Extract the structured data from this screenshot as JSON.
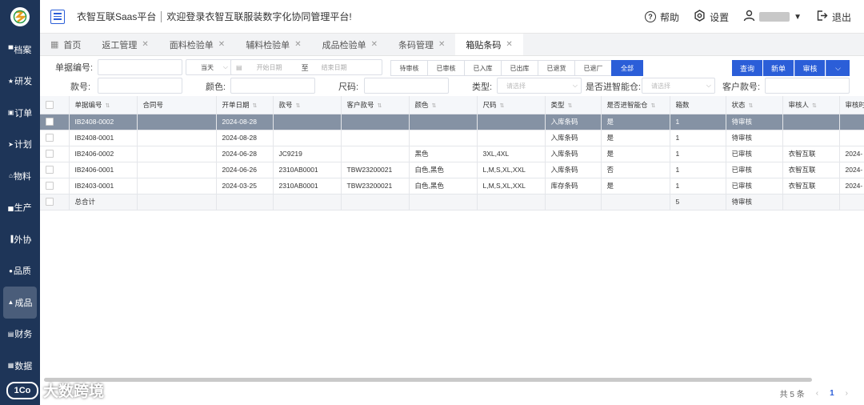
{
  "app": {
    "platform_name": "衣智互联Saas平台",
    "welcome": "欢迎登录衣智互联服装数字化协同管理平台!"
  },
  "topbar": {
    "help": "帮助",
    "settings": "设置",
    "logout": "退出"
  },
  "sidebar": {
    "items": [
      {
        "label": "档案",
        "icon": "archive-icon",
        "active": false
      },
      {
        "label": "研发",
        "icon": "star-icon",
        "active": false
      },
      {
        "label": "订单",
        "icon": "order-icon",
        "active": false
      },
      {
        "label": "计划",
        "icon": "send-icon",
        "active": false
      },
      {
        "label": "物料",
        "icon": "home-icon",
        "active": false
      },
      {
        "label": "生产",
        "icon": "factory-icon",
        "active": false
      },
      {
        "label": "外协",
        "icon": "chart-icon",
        "active": false
      },
      {
        "label": "品质",
        "icon": "check-circle-icon",
        "active": false
      },
      {
        "label": "成品",
        "icon": "bag-icon",
        "active": true
      },
      {
        "label": "财务",
        "icon": "wallet-icon",
        "active": false
      },
      {
        "label": "数据",
        "icon": "data-icon",
        "active": false
      }
    ]
  },
  "tabs": [
    {
      "label": "首页",
      "closable": false,
      "active": false
    },
    {
      "label": "返工管理",
      "closable": true,
      "active": false
    },
    {
      "label": "面料检验单",
      "closable": true,
      "active": false
    },
    {
      "label": "辅料检验单",
      "closable": true,
      "active": false
    },
    {
      "label": "成品检验单",
      "closable": true,
      "active": false
    },
    {
      "label": "条码管理",
      "closable": true,
      "active": false
    },
    {
      "label": "箱贴条码",
      "closable": true,
      "active": true
    }
  ],
  "filter": {
    "bill_no_label": "单据编号:",
    "date_select": "当天",
    "start_placeholder": "开始日期",
    "to": "至",
    "end_placeholder": "结束日期",
    "status_buttons": [
      "待审核",
      "已审核",
      "已入库",
      "已出库",
      "已退货",
      "已退厂",
      "全部"
    ],
    "query": "查询",
    "new": "新单",
    "audit": "审核",
    "style_label": "款号:",
    "color_label": "颜色:",
    "size_label": "尺码:",
    "type_label": "类型:",
    "type_placeholder": "请选择",
    "warehouse_label": "是否进智能仓:",
    "warehouse_placeholder": "请选择",
    "customer_label": "客户款号:"
  },
  "table": {
    "columns": [
      "单据编号",
      "合同号",
      "开单日期",
      "款号",
      "客户款号",
      "颜色",
      "尺码",
      "类型",
      "是否进智能仓",
      "箱数",
      "状态",
      "审核人",
      "审核时"
    ],
    "rows": [
      [
        "IB2408-0002",
        "",
        "2024-08-28",
        "",
        "",
        "",
        "",
        "入库条码",
        "是",
        "1",
        "待审核",
        "",
        ""
      ],
      [
        "IB2408-0001",
        "",
        "2024-08-28",
        "",
        "",
        "",
        "",
        "入库条码",
        "是",
        "1",
        "待审核",
        "",
        ""
      ],
      [
        "IB2406-0002",
        "",
        "2024-06-28",
        "JC9219",
        "",
        "黑色",
        "3XL,4XL",
        "入库条码",
        "是",
        "1",
        "已审核",
        "衣智互联",
        "2024-"
      ],
      [
        "IB2406-0001",
        "",
        "2024-06-26",
        "2310AB0001",
        "TBW23200021",
        "白色,黑色",
        "L,M,S,XL,XXL",
        "入库条码",
        "否",
        "1",
        "已审核",
        "衣智互联",
        "2024-"
      ],
      [
        "IB2403-0001",
        "",
        "2024-03-25",
        "2310AB0001",
        "TBW23200021",
        "白色,黑色",
        "L,M,S,XL,XXL",
        "库存条码",
        "是",
        "1",
        "已审核",
        "衣智互联",
        "2024-"
      ]
    ],
    "selected_row": 0,
    "total_label": "总合计",
    "total_boxes": "5",
    "total_status": "待审核"
  },
  "pager": {
    "total": "共 5 条",
    "page": "1"
  },
  "watermark": {
    "logo": "1Co",
    "text": "大数跨境"
  }
}
